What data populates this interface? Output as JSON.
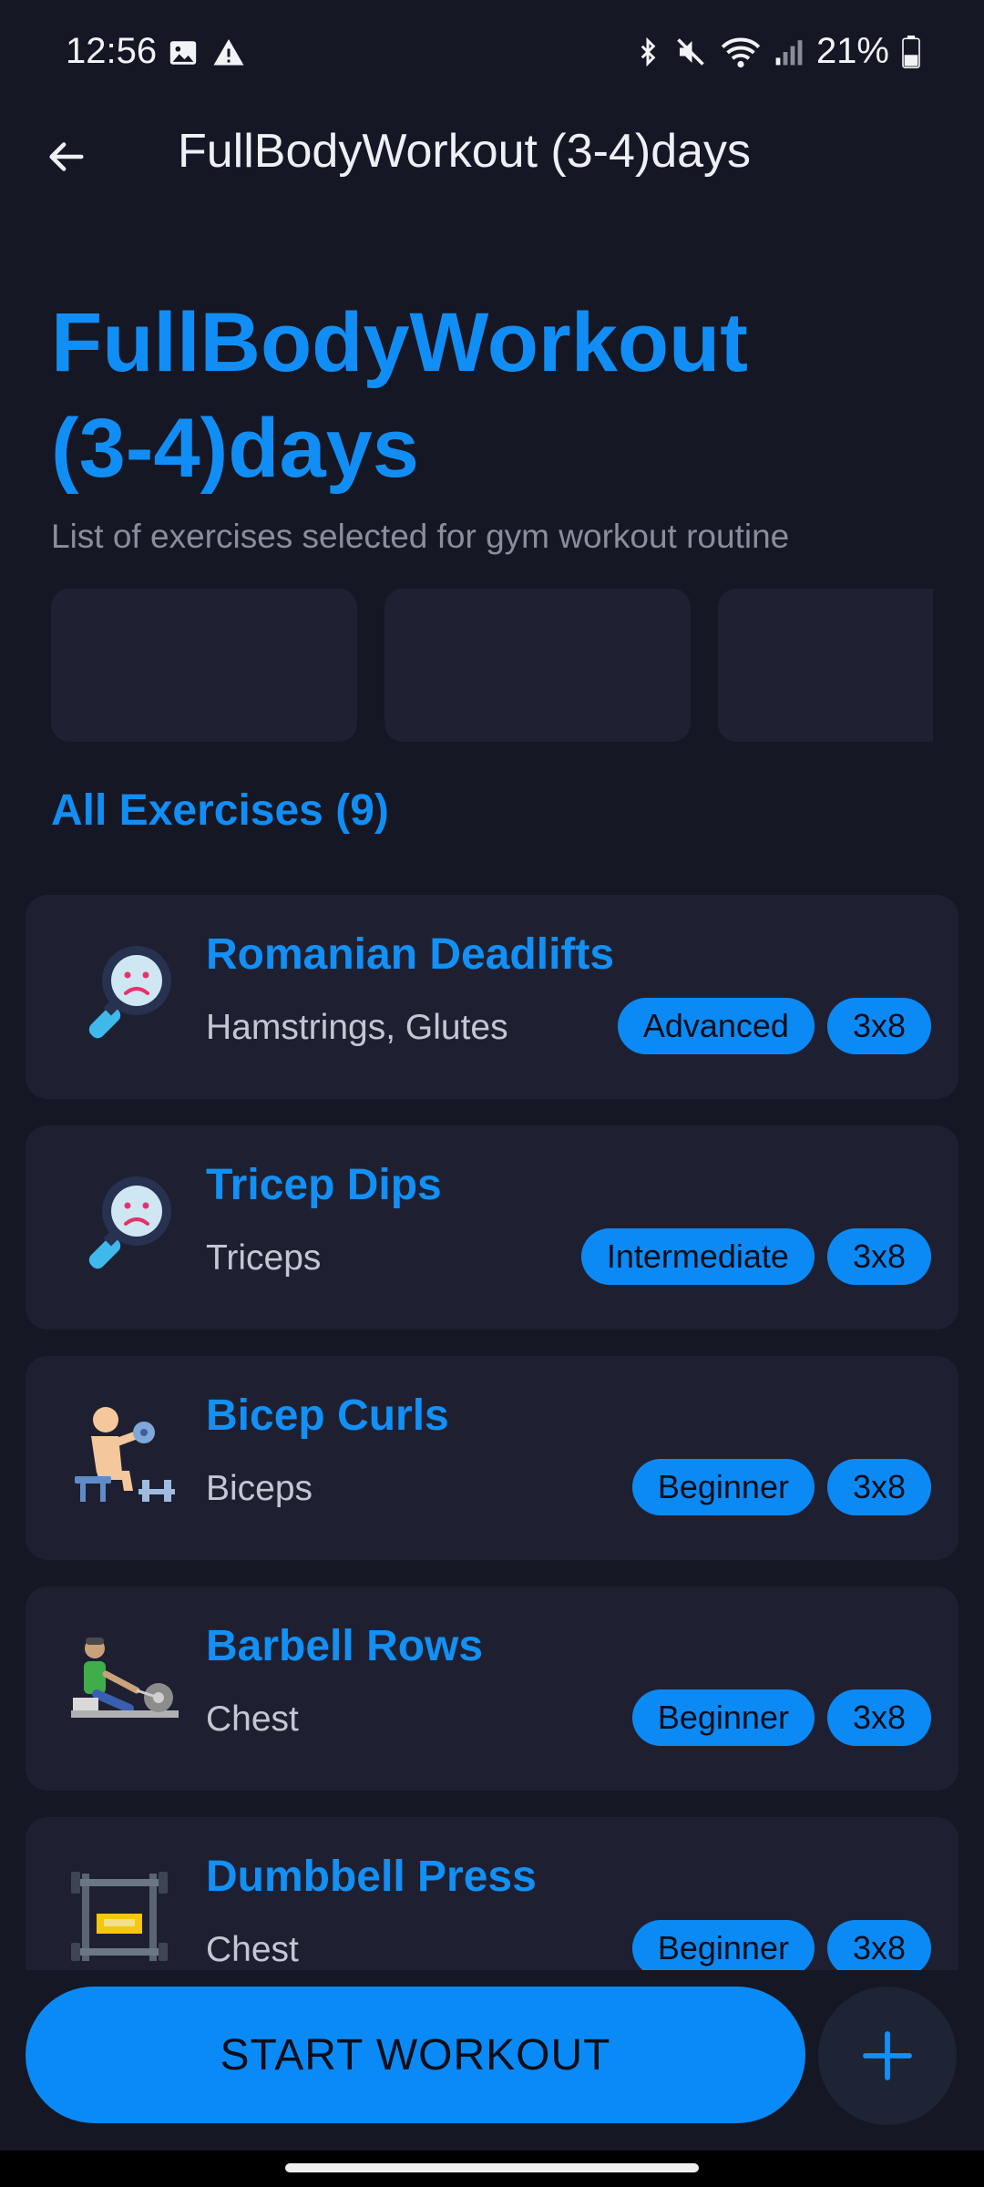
{
  "status_bar": {
    "time": "12:56",
    "battery": "21%",
    "icons": [
      "image-icon",
      "warning-icon",
      "bluetooth-icon",
      "mute-icon",
      "wifi-icon",
      "signal-icon",
      "battery-icon"
    ]
  },
  "app_bar": {
    "title": "FullBodyWorkout (3-4)days",
    "back_icon": "arrow-left-icon"
  },
  "header": {
    "title_line1": "FullBodyWorkout",
    "title_line2": "(3-4)days",
    "subtitle": "List of exercises selected for gym workout routine"
  },
  "section": {
    "title": "All Exercises (9)"
  },
  "exercises": [
    {
      "name": "Romanian Deadlifts",
      "muscles": "Hamstrings, Glutes",
      "level": "Advanced",
      "sets": "3x8",
      "icon": "magnifier-sad-icon"
    },
    {
      "name": "Tricep Dips",
      "muscles": "Triceps",
      "level": "Intermediate",
      "sets": "3x8",
      "icon": "magnifier-sad-icon"
    },
    {
      "name": "Bicep Curls",
      "muscles": "Biceps",
      "level": "Beginner",
      "sets": "3x8",
      "icon": "person-dumbbell-icon"
    },
    {
      "name": "Barbell Rows",
      "muscles": "Chest",
      "level": "Beginner",
      "sets": "3x8",
      "icon": "rowing-machine-icon"
    },
    {
      "name": "Dumbbell Press",
      "muscles": "Chest",
      "level": "Beginner",
      "sets": "3x8",
      "icon": "weight-rack-icon"
    }
  ],
  "actions": {
    "start_label": "START WORKOUT",
    "add_icon": "plus-icon"
  },
  "colors": {
    "background": "#151724",
    "card": "#1e2031",
    "accent": "#118ef5"
  }
}
